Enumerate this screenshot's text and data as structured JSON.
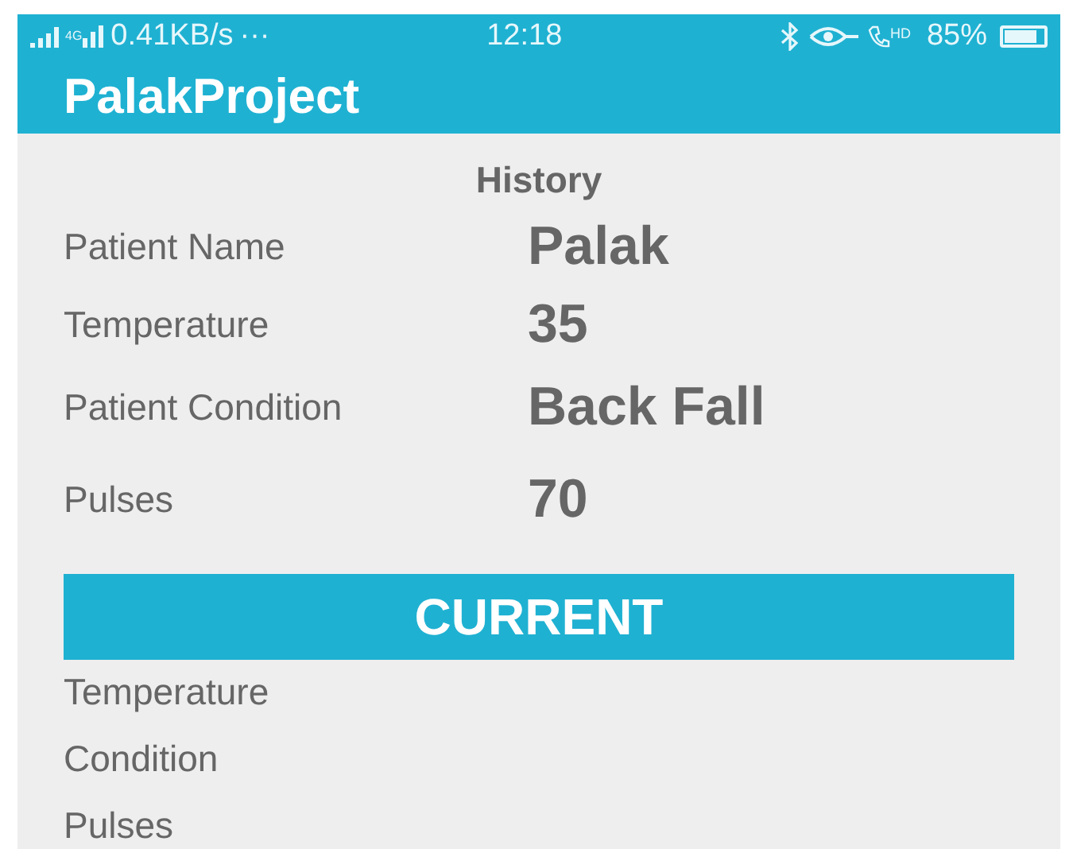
{
  "status_bar": {
    "network": "4G",
    "speed": "0.41KB/s",
    "more": "···",
    "time": "12:18",
    "call_badge": "HD",
    "battery": "85%"
  },
  "app_bar": {
    "title": "PalakProject"
  },
  "history": {
    "title": "History",
    "rows": [
      {
        "label": "Patient Name",
        "value": "Palak"
      },
      {
        "label": "Temperature",
        "value": "35"
      },
      {
        "label": "Patient Condition",
        "value": "Back Fall"
      },
      {
        "label": "Pulses",
        "value": "70"
      }
    ]
  },
  "current": {
    "title": "CURRENT",
    "rows": [
      {
        "label": "Temperature"
      },
      {
        "label": "Condition"
      },
      {
        "label": "Pulses"
      }
    ]
  }
}
